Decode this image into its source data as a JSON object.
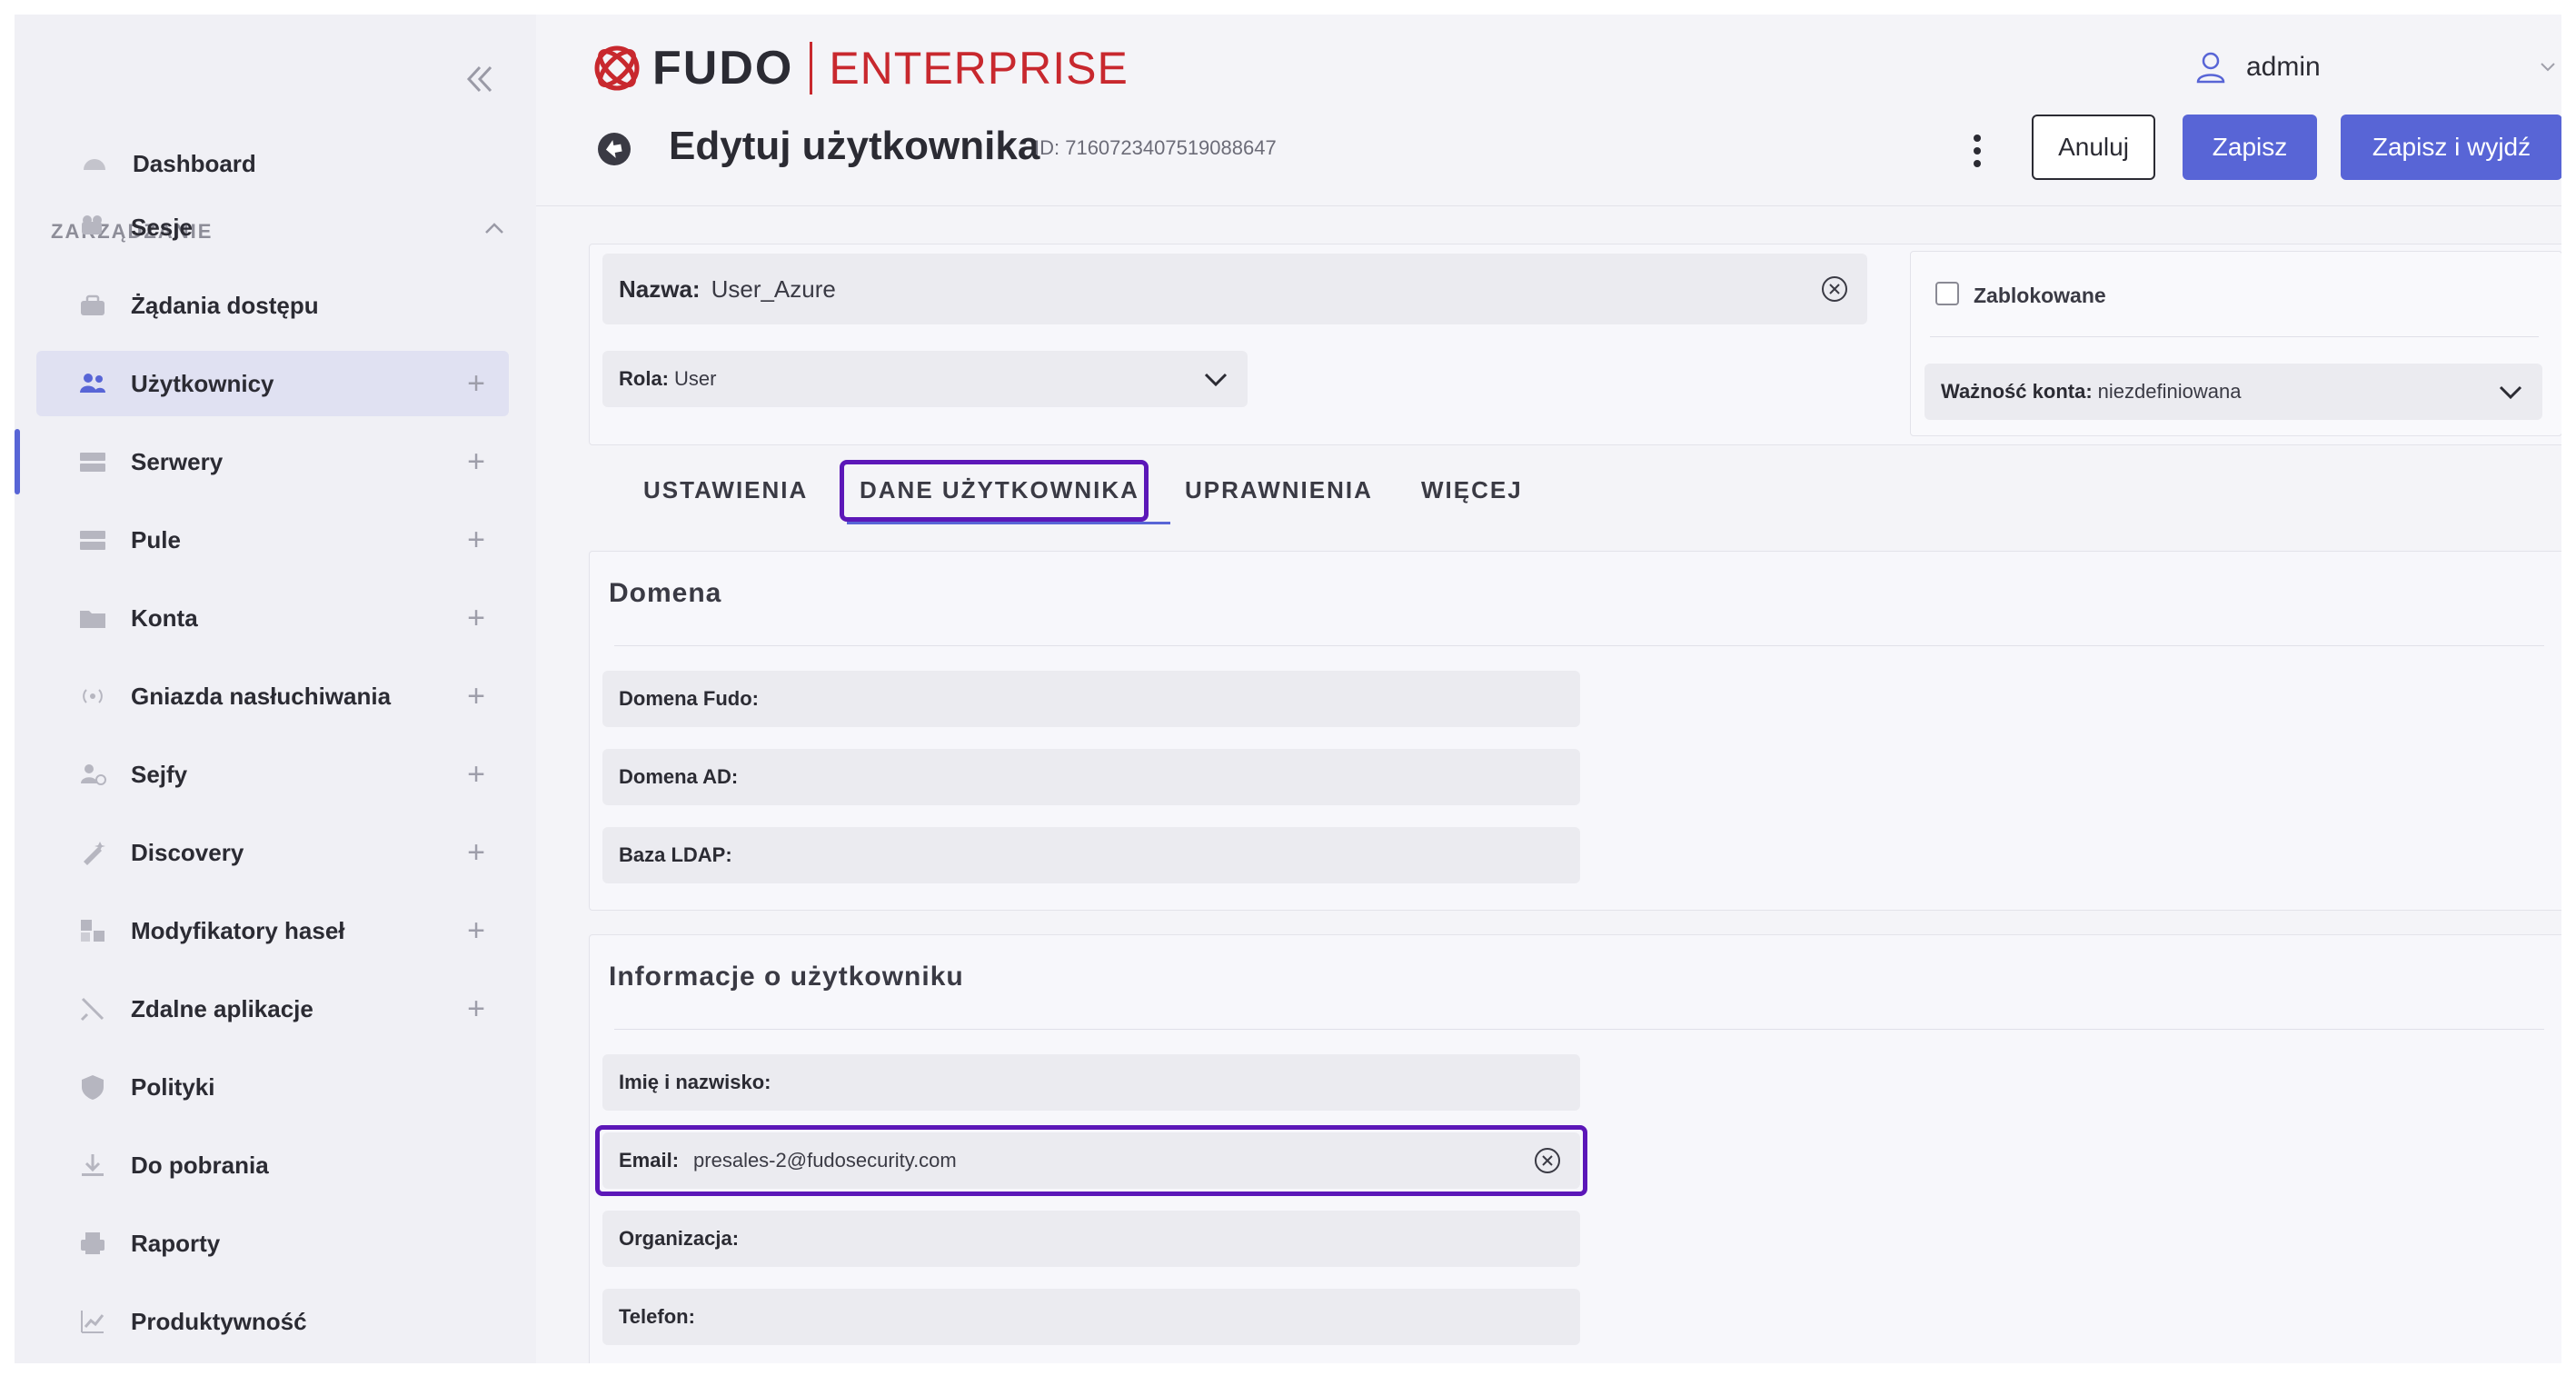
{
  "brand": {
    "name": "FUDO",
    "product": "ENTERPRISE",
    "accent": "#c8282e",
    "primary": "#5865d6"
  },
  "user": {
    "name": "admin"
  },
  "sidebar": {
    "dashboard": "Dashboard",
    "section": "ZARZĄDZANIE",
    "items": [
      {
        "label": "Sesje",
        "icon": "sessions-icon",
        "plus": false
      },
      {
        "label": "Żądania dostępu",
        "icon": "access-requests-icon",
        "plus": false
      },
      {
        "label": "Użytkownicy",
        "icon": "users-icon",
        "plus": true,
        "active": true
      },
      {
        "label": "Serwery",
        "icon": "servers-icon",
        "plus": true
      },
      {
        "label": "Pule",
        "icon": "pools-icon",
        "plus": true
      },
      {
        "label": "Konta",
        "icon": "accounts-icon",
        "plus": true
      },
      {
        "label": "Gniazda nasłuchiwania",
        "icon": "listeners-icon",
        "plus": true
      },
      {
        "label": "Sejfy",
        "icon": "safes-icon",
        "plus": true
      },
      {
        "label": "Discovery",
        "icon": "discovery-icon",
        "plus": true
      },
      {
        "label": "Modyfikatory haseł",
        "icon": "password-changers-icon",
        "plus": true
      },
      {
        "label": "Zdalne aplikacje",
        "icon": "remote-apps-icon",
        "plus": true
      },
      {
        "label": "Polityki",
        "icon": "policies-icon",
        "plus": false
      },
      {
        "label": "Do pobrania",
        "icon": "downloads-icon",
        "plus": false
      },
      {
        "label": "Raporty",
        "icon": "reports-icon",
        "plus": false
      },
      {
        "label": "Produktywność",
        "icon": "productivity-icon",
        "plus": false
      }
    ],
    "plus_glyph": "+"
  },
  "page": {
    "title": "Edytuj użytkownika",
    "id": "ID: 7160723407519088647",
    "cancel": "Anuluj",
    "save": "Zapisz",
    "save_exit": "Zapisz i wyjdź"
  },
  "top": {
    "name_label": "Nazwa:",
    "name_value": "User_Azure",
    "role_label": "Rola:",
    "role_value": "User",
    "blocked_label": "Zablokowane",
    "validity_label": "Ważność konta:",
    "validity_value": "niezdefiniowana"
  },
  "tabs": [
    "USTAWIENIA",
    "DANE UŻYTKOWNIKA",
    "UPRAWNIENIA",
    "WIĘCEJ"
  ],
  "domain_section": {
    "title": "Domena",
    "fields": [
      "Domena Fudo:",
      "Domena AD:",
      "Baza LDAP:"
    ]
  },
  "info_section": {
    "title": "Informacje o użytkowniku",
    "fullname": "Imię i nazwisko:",
    "email_label": "Email:",
    "email_value": "presales-2@fudosecurity.com",
    "org": "Organizacja:",
    "phone": "Telefon:"
  }
}
